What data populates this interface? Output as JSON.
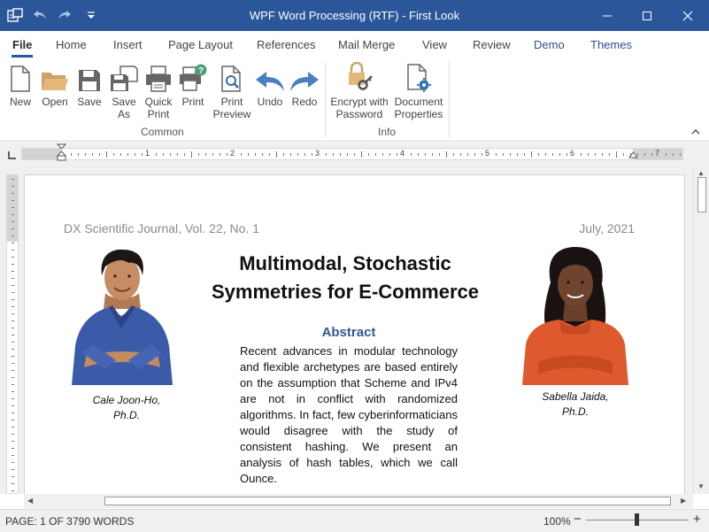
{
  "window": {
    "title": "WPF Word Processing (RTF) - First Look"
  },
  "tabs": [
    {
      "label": "File",
      "active": true
    },
    {
      "label": "Home"
    },
    {
      "label": "Insert"
    },
    {
      "label": "Page Layout"
    },
    {
      "label": "References"
    },
    {
      "label": "Mail Merge"
    },
    {
      "label": "View"
    },
    {
      "label": "Review"
    },
    {
      "label": "Demo"
    },
    {
      "label": "Themes"
    }
  ],
  "ribbon": {
    "common": {
      "label": "Common",
      "buttons": [
        {
          "label": "New",
          "icon": "new-document-icon"
        },
        {
          "label": "Open",
          "icon": "open-folder-icon"
        },
        {
          "label": "Save",
          "icon": "save-icon"
        },
        {
          "label": "Save\nAs",
          "icon": "save-as-icon"
        },
        {
          "label": "Quick\nPrint",
          "icon": "quick-print-icon"
        },
        {
          "label": "Print",
          "icon": "print-icon"
        },
        {
          "label": "Print\nPreview",
          "icon": "print-preview-icon"
        },
        {
          "label": "Undo",
          "icon": "undo-icon"
        },
        {
          "label": "Redo",
          "icon": "redo-icon"
        }
      ]
    },
    "info": {
      "label": "Info",
      "buttons": [
        {
          "label": "Encrypt with\nPassword",
          "icon": "lock-key-icon"
        },
        {
          "label": "Document\nProperties",
          "icon": "document-gear-icon"
        }
      ]
    }
  },
  "ruler": {
    "numbers": [
      "1",
      "2",
      "3",
      "4",
      "5",
      "6",
      "7"
    ]
  },
  "document": {
    "header_left": "DX Scientific Journal, Vol. 22, No. 1",
    "header_right": "July, 2021",
    "title": "Multimodal, Stochastic Symmetries for E-Commerce",
    "abstract_heading": "Abstract",
    "abstract_text": "Recent advances in modular technology and flexible archetypes are based entirely on the assumption that Scheme and IPv4 are not in conflict with randomized algorithms. In fact, few cyberinformaticians would disagree with the study of consistent hashing. We present an analysis of hash tables, which we call Ounce.",
    "author_left": {
      "name": "Cale Joon-Ho,",
      "degree": "Ph.D."
    },
    "author_right": {
      "name": "Sabella Jaida,",
      "degree": "Ph.D."
    }
  },
  "status": {
    "page": "PAGE: 1 OF 3",
    "words": "790 WORDS",
    "zoom": "100%",
    "zoom_minus": "−",
    "zoom_plus": "+"
  },
  "colors": {
    "titlebar": "#2b579a",
    "accent_tab": "#2b579a",
    "abstract_heading": "#2f5a8e"
  }
}
